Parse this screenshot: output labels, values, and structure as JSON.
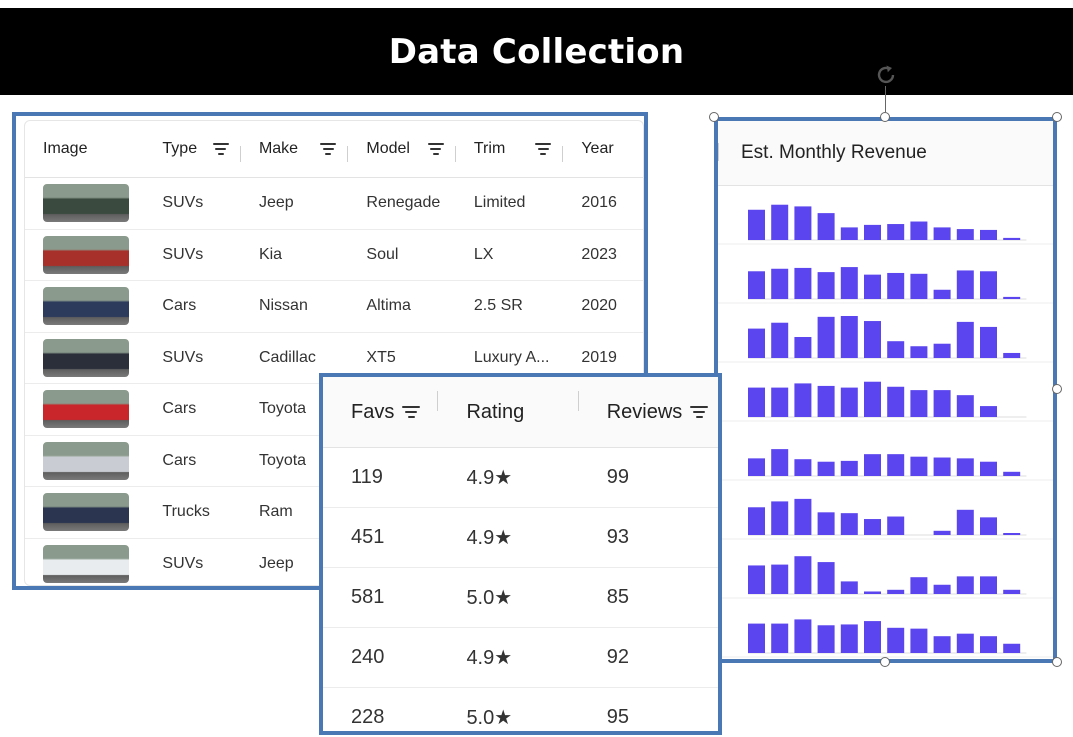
{
  "header": {
    "title": "Data Collection"
  },
  "listings": {
    "columns": {
      "image": "Image",
      "type": "Type",
      "make": "Make",
      "model": "Model",
      "trim": "Trim",
      "year": "Year"
    },
    "rows": [
      {
        "type": "SUVs",
        "make": "Jeep",
        "model": "Renegade",
        "trim": "Limited",
        "year": "2016"
      },
      {
        "type": "SUVs",
        "make": "Kia",
        "model": "Soul",
        "trim": "LX",
        "year": "2023"
      },
      {
        "type": "Cars",
        "make": "Nissan",
        "model": "Altima",
        "trim": "2.5 SR",
        "year": "2020"
      },
      {
        "type": "SUVs",
        "make": "Cadillac",
        "model": "XT5",
        "trim": "Luxury A...",
        "year": "2019"
      },
      {
        "type": "Cars",
        "make": "Toyota",
        "model": "",
        "trim": "",
        "year": ""
      },
      {
        "type": "Cars",
        "make": "Toyota",
        "model": "",
        "trim": "",
        "year": ""
      },
      {
        "type": "Trucks",
        "make": "Ram",
        "model": "",
        "trim": "",
        "year": ""
      },
      {
        "type": "SUVs",
        "make": "Jeep",
        "model": "",
        "trim": "",
        "year": ""
      }
    ],
    "thumb_colors": [
      "#3a4a3e",
      "#a8302a",
      "#2c3a5c",
      "#2a2f3a",
      "#c8262a",
      "#c9ccd2",
      "#2b3550",
      "#e9ecef"
    ]
  },
  "revenue": {
    "header": "Est. Monthly Revenue",
    "bar_color": "#5b45ee",
    "rows": [
      [
        0.72,
        0.84,
        0.8,
        0.64,
        0.3,
        0.36,
        0.38,
        0.44,
        0.3,
        0.26,
        0.24,
        0.05
      ],
      [
        0.66,
        0.72,
        0.74,
        0.64,
        0.76,
        0.58,
        0.62,
        0.6,
        0.22,
        0.68,
        0.66,
        0.05
      ],
      [
        0.7,
        0.84,
        0.5,
        0.98,
        1.0,
        0.88,
        0.4,
        0.28,
        0.34,
        0.86,
        0.74,
        0.12
      ],
      [
        0.7,
        0.7,
        0.8,
        0.74,
        0.7,
        0.84,
        0.72,
        0.64,
        0.64,
        0.52,
        0.26,
        0.0
      ],
      [
        0.42,
        0.64,
        0.4,
        0.34,
        0.36,
        0.52,
        0.52,
        0.46,
        0.44,
        0.42,
        0.34,
        0.1
      ],
      [
        0.66,
        0.8,
        0.86,
        0.54,
        0.52,
        0.38,
        0.44,
        0.0,
        0.1,
        0.6,
        0.42,
        0.04
      ],
      [
        0.68,
        0.7,
        0.9,
        0.76,
        0.3,
        0.06,
        0.1,
        0.4,
        0.22,
        0.42,
        0.42,
        0.1
      ],
      [
        0.7,
        0.7,
        0.8,
        0.66,
        0.68,
        0.76,
        0.6,
        0.58,
        0.4,
        0.46,
        0.4,
        0.22
      ]
    ]
  },
  "ratings": {
    "columns": {
      "favs": "Favs",
      "rating": "Rating",
      "reviews": "Reviews"
    },
    "rows": [
      {
        "favs": "119",
        "rating": "4.9★",
        "reviews": "99"
      },
      {
        "favs": "451",
        "rating": "4.9★",
        "reviews": "93"
      },
      {
        "favs": "581",
        "rating": "5.0★",
        "reviews": "85"
      },
      {
        "favs": "240",
        "rating": "4.9★",
        "reviews": "92"
      },
      {
        "favs": "228",
        "rating": "5.0★",
        "reviews": "95"
      }
    ]
  }
}
